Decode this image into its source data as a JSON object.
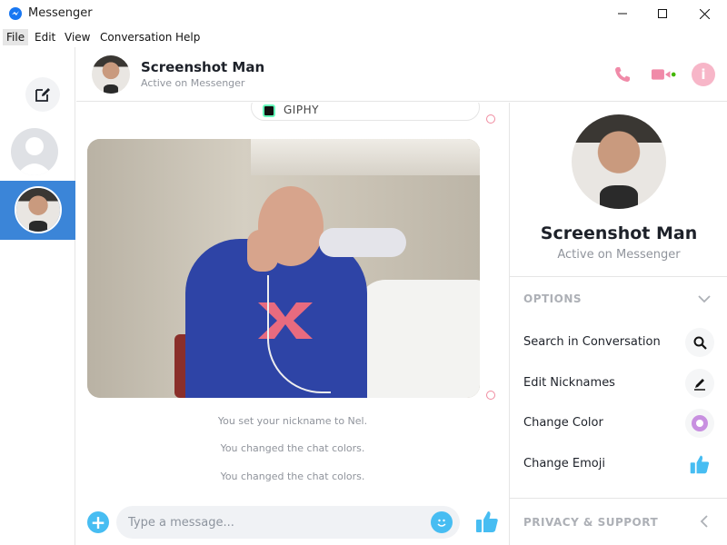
{
  "window": {
    "title": "Messenger",
    "controls": [
      "minimize",
      "maximize",
      "close"
    ]
  },
  "menu": {
    "items": [
      "File",
      "Edit",
      "View",
      "Conversation",
      "Help"
    ]
  },
  "sidebar": {
    "compose_icon": "compose-icon",
    "conversations": [
      {
        "name": "",
        "active": false
      },
      {
        "name": "Screenshot Man",
        "active": true
      }
    ]
  },
  "conversation": {
    "contact_name": "Screenshot Man",
    "status": "Active on Messenger",
    "actions": [
      "phone-icon",
      "video-icon",
      "info-icon"
    ]
  },
  "messages": {
    "giphy_label": "GIPHY",
    "system": [
      "You set your nickname to Nel.",
      "You changed the chat colors.",
      "You changed the chat colors."
    ]
  },
  "composer": {
    "placeholder": "Type a message..."
  },
  "info_panel": {
    "name": "Screenshot Man",
    "status": "Active on Messenger",
    "options_title": "OPTIONS",
    "options": [
      {
        "label": "Search in Conversation",
        "icon": "search-icon"
      },
      {
        "label": "Edit Nicknames",
        "icon": "pencil-icon"
      },
      {
        "label": "Change Color",
        "icon": "color-icon"
      },
      {
        "label": "Change Emoji",
        "icon": "thumbs-up-icon"
      }
    ],
    "privacy_title": "PRIVACY & SUPPORT"
  },
  "colors": {
    "accent": "#47bdf2",
    "header_icons": "#f08aa8",
    "active_row": "#3b85d8"
  }
}
